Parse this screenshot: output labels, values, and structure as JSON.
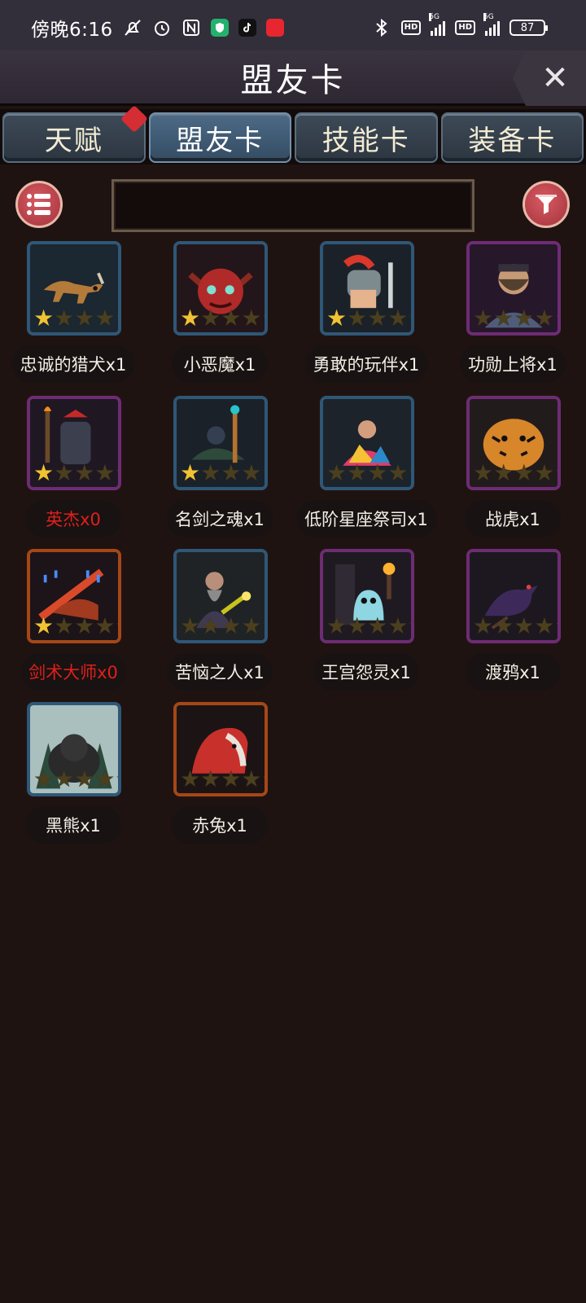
{
  "status_bar": {
    "time": "傍晚6:16",
    "net1": "5G",
    "net2": "5G",
    "hd": "HD",
    "battery": "87",
    "app_icons": [
      "vpn-shield-icon",
      "tiktok-icon",
      "app-icon"
    ]
  },
  "header": {
    "title": "盟友卡",
    "close_label": "✕"
  },
  "tabs": [
    {
      "label": "天赋",
      "active": false,
      "badge": true
    },
    {
      "label": "盟友卡",
      "active": true,
      "badge": false
    },
    {
      "label": "技能卡",
      "active": false,
      "badge": false
    },
    {
      "label": "装备卡",
      "active": false,
      "badge": false
    }
  ],
  "search": {
    "value": "",
    "placeholder": ""
  },
  "colors": {
    "frame_blue": "#2f5777",
    "frame_purple": "#6e2c74",
    "frame_orange": "#a54717",
    "star_on": "#f1c232",
    "unowned_name": "#e0201a"
  },
  "cards": [
    {
      "name": "忠诚的猎犬x1",
      "rarity": "blue",
      "stars": 1,
      "owned": true,
      "icon": "hound-icon"
    },
    {
      "name": "小恶魔x1",
      "rarity": "blue",
      "stars": 1,
      "owned": true,
      "icon": "imp-icon"
    },
    {
      "name": "勇敢的玩伴x1",
      "rarity": "blue",
      "stars": 1,
      "owned": true,
      "icon": "knight-icon"
    },
    {
      "name": "功勋上将x1",
      "rarity": "purple",
      "stars": 0,
      "owned": true,
      "icon": "general-icon"
    },
    {
      "name": "英杰x0",
      "rarity": "purple",
      "stars": 1,
      "owned": false,
      "icon": "hero-icon"
    },
    {
      "name": "名剑之魂x1",
      "rarity": "blue",
      "stars": 1,
      "owned": true,
      "icon": "sword-soul-icon"
    },
    {
      "name": "低阶星座祭司x1",
      "rarity": "blue",
      "stars": 0,
      "owned": true,
      "icon": "priest-icon"
    },
    {
      "name": "战虎x1",
      "rarity": "purple",
      "stars": 0,
      "owned": true,
      "icon": "tiger-icon"
    },
    {
      "name": "剑术大师x0",
      "rarity": "orange",
      "stars": 1,
      "owned": false,
      "icon": "sword-master-icon"
    },
    {
      "name": "苦恼之人x1",
      "rarity": "blue",
      "stars": 0,
      "owned": true,
      "icon": "wizard-icon"
    },
    {
      "name": "王宫怨灵x1",
      "rarity": "purple",
      "stars": 0,
      "owned": true,
      "icon": "ghost-icon"
    },
    {
      "name": "渡鸦x1",
      "rarity": "purple",
      "stars": 0,
      "owned": true,
      "icon": "raven-icon"
    },
    {
      "name": "黑熊x1",
      "rarity": "blue",
      "stars": 0,
      "owned": true,
      "icon": "bear-icon"
    },
    {
      "name": "赤兔x1",
      "rarity": "orange",
      "stars": 0,
      "owned": true,
      "icon": "red-horse-icon"
    }
  ]
}
